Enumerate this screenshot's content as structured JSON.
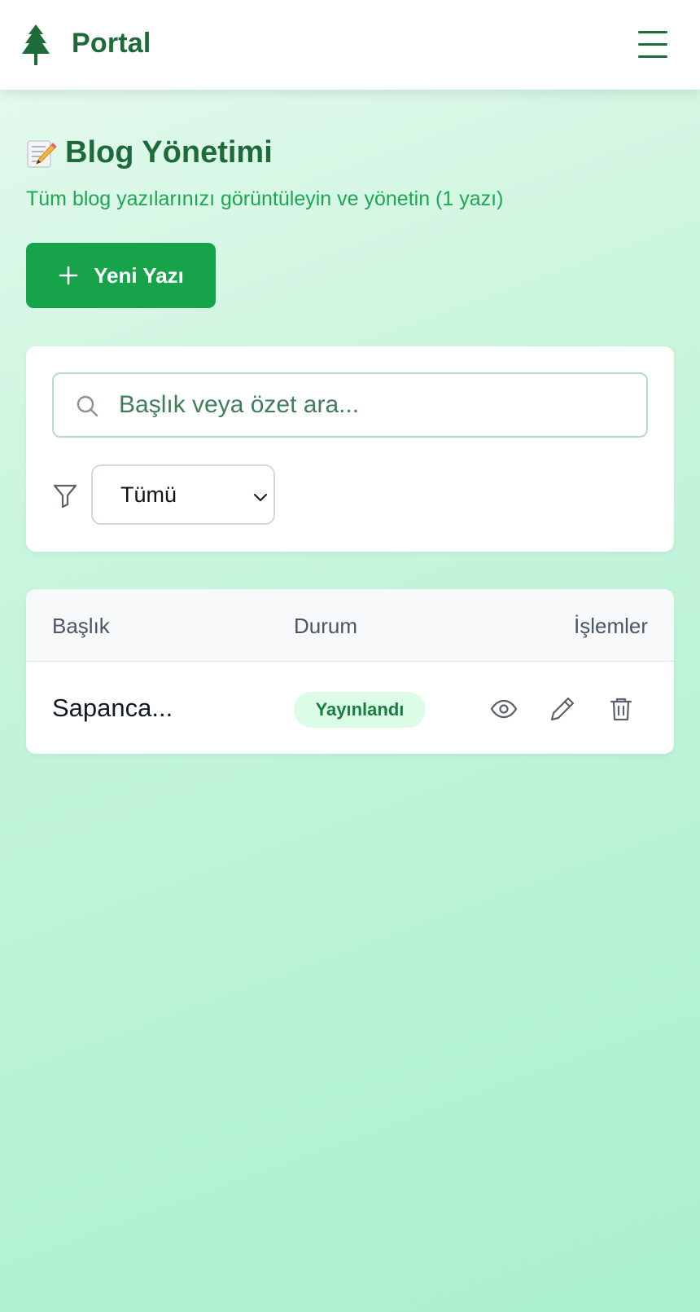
{
  "header": {
    "brand": "Portal",
    "logo_icon": "tree-icon",
    "menu_icon": "hamburger-icon"
  },
  "page": {
    "title_emoji": "memo-emoji",
    "title": "Blog Yönetimi",
    "subtitle": "Tüm blog yazılarınızı görüntüleyin ve yönetin (1 yazı)",
    "new_button_label": "Yeni Yazı"
  },
  "filters": {
    "search_placeholder": "Başlık veya özet ara...",
    "search_value": "",
    "status_selected": "Tümü"
  },
  "table": {
    "headers": {
      "title": "Başlık",
      "status": "Durum",
      "actions": "İşlemler"
    },
    "rows": [
      {
        "title": "Sapanca...",
        "status": "Yayınlandı"
      }
    ]
  },
  "colors": {
    "brand": "#1e6b3a",
    "accent": "#16a34a",
    "badge_bg": "#dcfce7",
    "badge_text": "#15803d"
  }
}
